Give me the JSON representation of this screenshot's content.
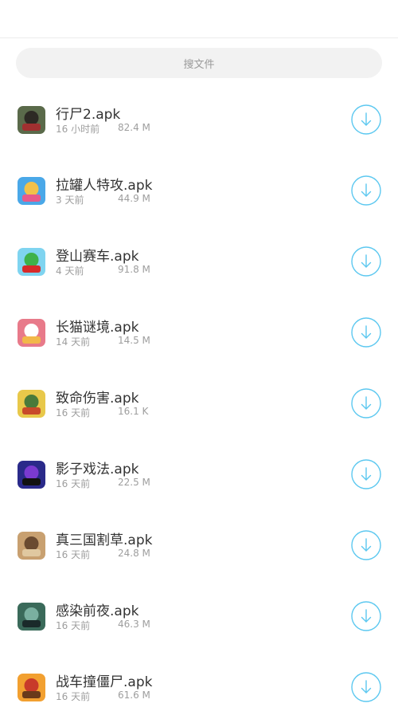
{
  "search": {
    "placeholder": "搜文件"
  },
  "accent_color": "#5cc8f0",
  "files": [
    {
      "name": "行尸2.apk",
      "time": "16 小时前",
      "size": "82.4 M",
      "icon": "walking-dead-game-icon",
      "colors": [
        "#5a6a4a",
        "#2d2a24",
        "#a03030"
      ]
    },
    {
      "name": "拉罐人特攻.apk",
      "time": "3 天前",
      "size": "44.9 M",
      "icon": "can-man-game-icon",
      "colors": [
        "#4aa8e8",
        "#f2c14a",
        "#e85a8a"
      ]
    },
    {
      "name": "登山赛车.apk",
      "time": "4 天前",
      "size": "91.8 M",
      "icon": "hill-climb-car-icon",
      "colors": [
        "#7fd4f0",
        "#3fb14a",
        "#d82a2a"
      ]
    },
    {
      "name": "长猫谜境.apk",
      "time": "14 天前",
      "size": "14.5 M",
      "icon": "long-cat-game-icon",
      "colors": [
        "#e87a8a",
        "#ffffff",
        "#f2b84a"
      ]
    },
    {
      "name": "致命伤害.apk",
      "time": "16 天前",
      "size": "16.1 K",
      "icon": "lethal-damage-game-icon",
      "colors": [
        "#e8c84a",
        "#4a7a3a",
        "#c84a2a"
      ]
    },
    {
      "name": "影子戏法.apk",
      "time": "16 天前",
      "size": "22.5 M",
      "icon": "shadow-trick-game-icon",
      "colors": [
        "#2a2a8a",
        "#7a3ad0",
        "#111111"
      ]
    },
    {
      "name": "真三国割草.apk",
      "time": "16 天前",
      "size": "24.8 M",
      "icon": "three-kingdoms-game-icon",
      "colors": [
        "#c8a070",
        "#6a4a30",
        "#e0c8a0"
      ]
    },
    {
      "name": "感染前夜.apk",
      "time": "16 天前",
      "size": "46.3 M",
      "icon": "infection-eve-game-icon",
      "colors": [
        "#3a6a5a",
        "#7ab0a0",
        "#1a2a2a"
      ]
    },
    {
      "name": "战车撞僵尸.apk",
      "time": "16 天前",
      "size": "61.6 M",
      "icon": "tank-zombie-game-icon",
      "colors": [
        "#f2a030",
        "#c83a2a",
        "#6a3a1a"
      ]
    }
  ]
}
